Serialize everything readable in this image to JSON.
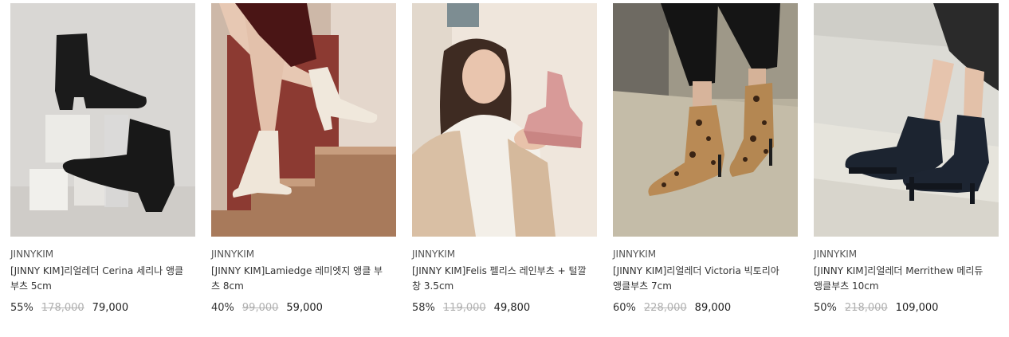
{
  "products": [
    {
      "image_alt": "black ankle boots on white blocks",
      "brand": "JINNYKIM",
      "name": "[JINNY KIM]리얼레더 Cerina 세리나 앵클 부츠 5cm",
      "discount": "55%",
      "original_price": "178,000",
      "sale_price": "79,000"
    },
    {
      "image_alt": "ivory ankle boots on steps",
      "brand": "JINNYKIM",
      "name": "[JINNY KIM]Lamiedge 레미엣지 앵클 부츠 8cm",
      "discount": "40%",
      "original_price": "99,000",
      "sale_price": "59,000"
    },
    {
      "image_alt": "model holding pink rain boot",
      "brand": "JINNYKIM",
      "name": "[JINNY KIM]Felis 펠리스 레인부츠 + 털깔창 3.5cm",
      "discount": "58%",
      "original_price": "119,000",
      "sale_price": "49,800"
    },
    {
      "image_alt": "leopard print stiletto ankle boots",
      "brand": "JINNYKIM",
      "name": "[JINNY KIM]리얼레더 Victoria 빅토리아 앵클부츠 7cm",
      "discount": "60%",
      "original_price": "228,000",
      "sale_price": "89,000"
    },
    {
      "image_alt": "navy platform ankle boots",
      "brand": "JINNYKIM",
      "name": "[JINNY KIM]리얼레더 Merrithew 메리듀 앵클부츠 10cm",
      "discount": "50%",
      "original_price": "218,000",
      "sale_price": "109,000"
    }
  ]
}
